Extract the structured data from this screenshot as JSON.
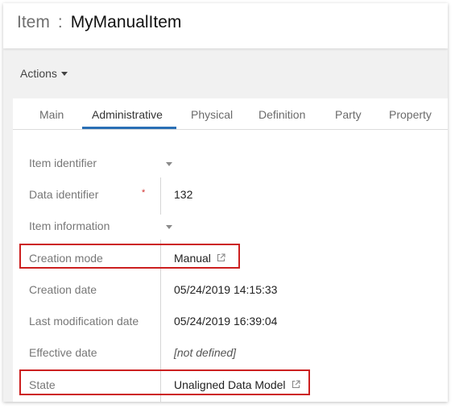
{
  "header": {
    "item_type": "Item",
    "separator": ":",
    "item_name": "MyManualItem"
  },
  "toolbar": {
    "actions_label": "Actions"
  },
  "tabs": [
    {
      "label": "Main",
      "active": false
    },
    {
      "label": "Administrative",
      "active": true
    },
    {
      "label": "Physical",
      "active": false
    },
    {
      "label": "Definition",
      "active": false
    },
    {
      "label": "Party",
      "active": false
    },
    {
      "label": "Property",
      "active": false
    }
  ],
  "fields": {
    "item_identifier": {
      "label": "Item identifier"
    },
    "data_identifier": {
      "label": "Data identifier",
      "required_mark": "*",
      "value": "132"
    },
    "item_information": {
      "label": "Item information"
    },
    "creation_mode": {
      "label": "Creation mode",
      "value": "Manual"
    },
    "creation_date": {
      "label": "Creation date",
      "value": "05/24/2019 14:15:33"
    },
    "last_modification_date": {
      "label": "Last modification date",
      "value": "05/24/2019 16:39:04"
    },
    "effective_date": {
      "label": "Effective date",
      "value": "[not defined]"
    },
    "state": {
      "label": "State",
      "value": "Unaligned Data Model"
    }
  },
  "colors": {
    "accent": "#2a6fb5",
    "highlight": "#cc2020",
    "required": "#d0302e"
  },
  "icons": {
    "external_link": "external-link-icon",
    "dropdown": "caret-down-icon"
  }
}
